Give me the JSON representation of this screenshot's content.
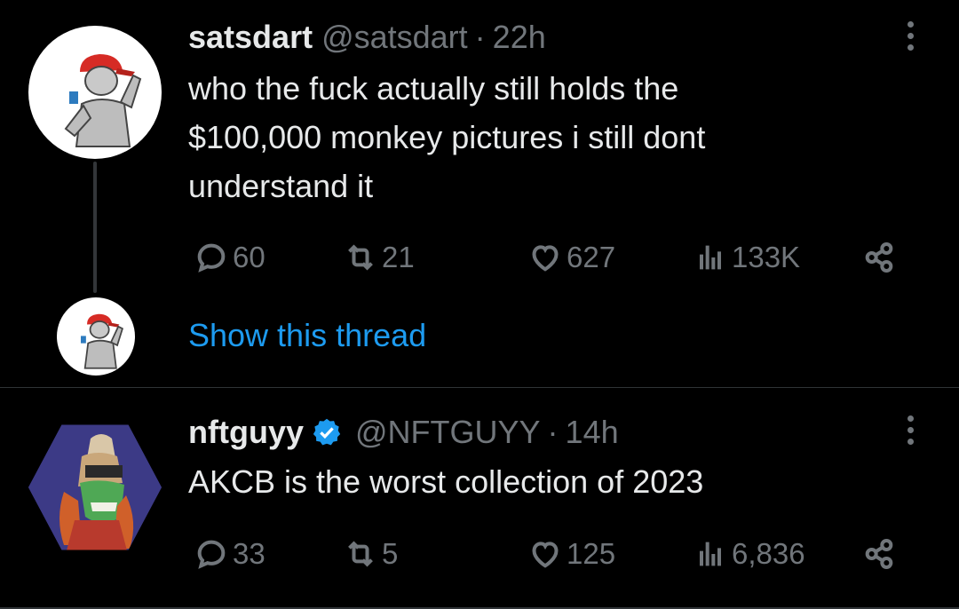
{
  "tweets": [
    {
      "name": "satsdart",
      "handle": "@satsdart",
      "dot": "·",
      "time": "22h",
      "text_lines": [
        "who the fuck actually still holds the",
        "$100,000 monkey pictures i still dont",
        "understand it"
      ],
      "replies": "60",
      "retweets": "21",
      "likes": "627",
      "views": "133K",
      "verified": false
    },
    {
      "name": "nftguyy",
      "handle": "@NFTGUYY",
      "dot": "·",
      "time": "14h",
      "text_lines": [
        "AKCB is the worst collection of 2023"
      ],
      "replies": "33",
      "retweets": "5",
      "likes": "125",
      "views": "6,836",
      "verified": true
    }
  ],
  "thread": {
    "show_label": "Show this thread"
  },
  "icons": {
    "reply": "reply-icon",
    "retweet": "retweet-icon",
    "like": "heart-icon",
    "views": "views-icon",
    "share": "share-icon",
    "more": "more-icon",
    "verified": "verified-badge-icon"
  },
  "colors": {
    "background": "#000000",
    "text": "#e7e9ea",
    "muted": "#71767b",
    "link": "#1d9bf0",
    "verified": "#1d9bf0"
  }
}
